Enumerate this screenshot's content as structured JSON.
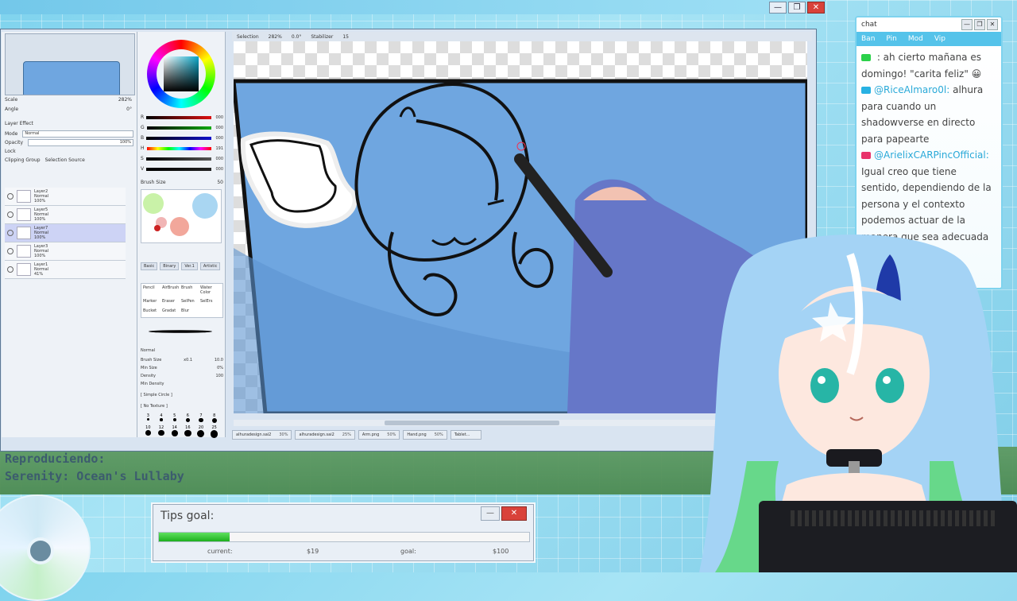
{
  "app_window": {
    "controls": [
      "—",
      "❐",
      "✕"
    ]
  },
  "navigator": {
    "scale_label": "Scale",
    "scale_value": "282%",
    "angle_label": "Angle",
    "angle_value": "0°"
  },
  "layer_effect": {
    "heading": "Layer Effect",
    "mode_label": "Mode",
    "mode_value": "Normal",
    "opacity_label": "Opacity",
    "opacity_value": "100%",
    "lock_label": "Lock",
    "clipping_group": "Clipping Group",
    "selection_source": "Selection Source"
  },
  "layers": [
    {
      "name": "Layer2",
      "mode": "Normal",
      "opacity": "100%",
      "active": false
    },
    {
      "name": "Layer5",
      "mode": "Normal",
      "opacity": "100%",
      "active": false
    },
    {
      "name": "Layer7",
      "mode": "Normal",
      "opacity": "100%",
      "active": true
    },
    {
      "name": "Layer3",
      "mode": "Normal",
      "opacity": "100%",
      "active": false
    },
    {
      "name": "Layer1",
      "mode": "Normal",
      "opacity": "41%",
      "active": false
    }
  ],
  "color_sliders": [
    {
      "label": "R",
      "value": "000",
      "color": "#d11"
    },
    {
      "label": "G",
      "value": "000",
      "color": "#1a1"
    },
    {
      "label": "B",
      "value": "000",
      "color": "#11c"
    },
    {
      "label": "H",
      "value": "191",
      "color": "rainbow"
    },
    {
      "label": "S",
      "value": "000",
      "color": "#555"
    },
    {
      "label": "V",
      "value": "000",
      "color": "#222"
    }
  ],
  "brush_size_header": {
    "label": "Brush Size",
    "value": "50"
  },
  "tool_tabs": [
    "Basic",
    "Binary",
    "Ver.1",
    "Artistic"
  ],
  "brushes": [
    "Pencil",
    "AirBrush",
    "Brush",
    "Water Color",
    "Marker",
    "Eraser",
    "SelPen",
    "SelErs",
    "Bucket",
    "Gradat",
    "Blur"
  ],
  "brush_props": {
    "mode": "Normal",
    "size_label": "Brush Size",
    "size_mult": "x0.1",
    "size_value": "10.0",
    "min_size_label": "Min Size",
    "min_size_value": "0%",
    "density_label": "Density",
    "density_value": "100",
    "min_density_label": "Min Density",
    "shape": "[ Simple Circle ]",
    "texture": "[ No Texture ]"
  },
  "brush_dot_sizes": [
    "3",
    "4",
    "5",
    "6",
    "7",
    "8",
    "10",
    "12",
    "14",
    "16",
    "20",
    "25"
  ],
  "canvas_toolbar": {
    "selection_label": "Selection",
    "zoom": "282%",
    "angle": "0.0°",
    "stabilizer_label": "Stabilizer",
    "stabilizer_value": "15"
  },
  "file_tabs": [
    {
      "name": "alhuradesign.sai2",
      "pct": "30%"
    },
    {
      "name": "alhuradesign.sai2",
      "pct": "25%"
    },
    {
      "name": "Arm.png",
      "pct": "50%"
    },
    {
      "name": "Hand.png",
      "pct": "50%"
    },
    {
      "name": "Tablet...",
      "pct": ""
    }
  ],
  "chat": {
    "title": "chat",
    "tabs": [
      "Ban",
      "Pin",
      "Mod",
      "Vip"
    ],
    "messages": [
      {
        "user": "",
        "text": ": ah cierto mañana es domingo! \"carita feliz\" 😀",
        "badge": "#2bd14a"
      },
      {
        "user": "@RiceAlmaro0l:",
        "text": "alhura para cuando un shadowverse en directo para papearte",
        "badge": "#27b1e3"
      },
      {
        "user": "@ArielixCARPincOfficial:",
        "text": "Igual creo que tiene sentido, dependiendo de la persona y el contexto podemos actuar de la manera que sea adecuada en...",
        "badge": "#e8336b"
      }
    ]
  },
  "now_playing": {
    "label": "Reproduciendo:",
    "track": "Serenity: Ocean's Lullaby"
  },
  "tips_goal": {
    "title": "Tips goal:",
    "minimize": "—",
    "close": "✕",
    "current_label": "current:",
    "current_value": "$19",
    "goal_label": "goal:",
    "goal_value": "$100",
    "progress": 0.19,
    "fill_color": "#22c322"
  },
  "colors": {
    "accent": "#55c3ea",
    "canvas_blue": "#6fa6e0"
  }
}
